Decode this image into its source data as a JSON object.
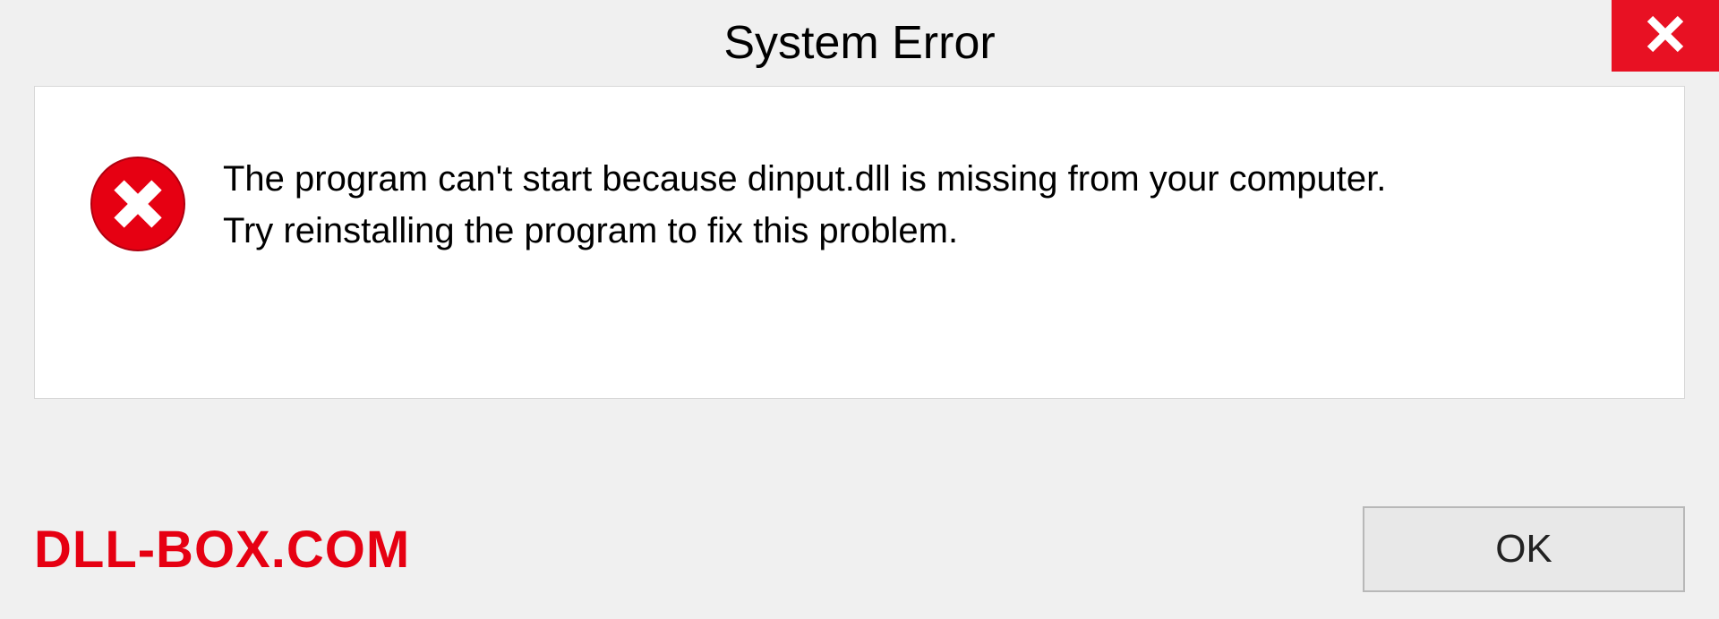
{
  "titlebar": {
    "title": "System Error"
  },
  "message": {
    "line1": "The program can't start because dinput.dll is missing from your computer.",
    "line2": "Try reinstalling the program to fix this problem."
  },
  "footer": {
    "watermark": "DLL-BOX.COM",
    "ok_label": "OK"
  },
  "colors": {
    "close_bg": "#e81123",
    "error_icon": "#e60012",
    "watermark": "#e60012"
  }
}
